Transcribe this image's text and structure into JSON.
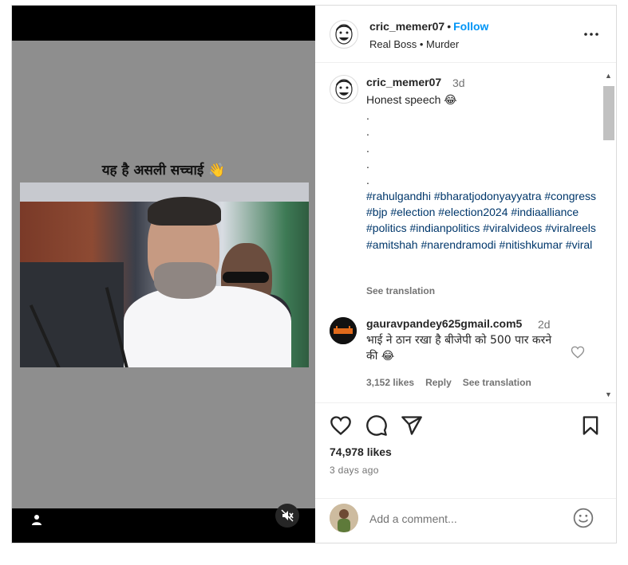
{
  "post": {
    "overlay_caption": "यह है असली सच्चाई 👋",
    "author": {
      "username": "cric_memer07",
      "separator": "•",
      "follow_label": "Follow",
      "subtitle": "Real Boss • Murder"
    },
    "caption": {
      "username": "cric_memer07",
      "time": "3d",
      "lines": [
        "Honest speech 😂",
        ".",
        ".",
        ".",
        ".",
        "."
      ],
      "hashtags": "#rahulgandhi #bharatjodonyayyatra #congress #bjp #election #election2024 #indiaalliance #politics #indianpolitics #viralvideos #viralreels #amitshah #narendramodi #nitishkumar #viral",
      "see_translation": "See translation"
    },
    "comments": [
      {
        "username": "gauravpandey625gmail.com5",
        "time": "2d",
        "text": "भाई ने ठान रखा है बीजेपी को 500 पार करने की 😂",
        "likes": "3,152 likes",
        "reply_label": "Reply",
        "see_translation": "See translation"
      }
    ],
    "likes": "74,978 likes",
    "posted_ago": "3 days ago",
    "add_comment_placeholder": "Add a comment..."
  },
  "icons": {
    "more": "more-options-icon",
    "like": "heart-icon",
    "comment": "comment-icon",
    "share": "share-icon",
    "save": "bookmark-icon",
    "emoji": "emoji-icon",
    "user_tags": "user-icon",
    "mute": "muted-speaker-icon"
  },
  "colors": {
    "accent": "#0095f6",
    "hashtag": "#00376b",
    "muted_text": "#737373"
  }
}
